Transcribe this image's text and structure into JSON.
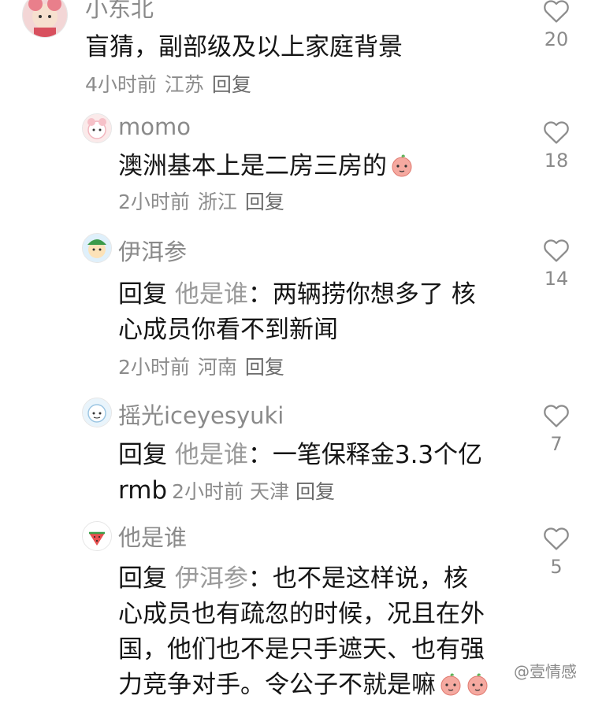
{
  "comments": [
    {
      "username": "小东北",
      "text": "盲猜，副部级及以上家庭背景",
      "time": "4小时前",
      "location": "江苏",
      "reply_label": "回复",
      "likes": "20"
    },
    {
      "username": "momo",
      "text": "澳洲基本上是二房三房的",
      "time": "2小时前",
      "location": "浙江",
      "reply_label": "回复",
      "likes": "18"
    },
    {
      "username": "伊洱参",
      "reply_prefix": "回复",
      "reply_target": "他是谁",
      "text_line1": "：两辆捞你想多了 核",
      "text_line2": "心成员你看不到新闻",
      "time": "2小时前",
      "location": "河南",
      "reply_label": "回复",
      "likes": "14"
    },
    {
      "username": "摇光iceyesyuki",
      "reply_prefix": "回复",
      "reply_target": "他是谁",
      "text_line1": "：一笔保释金3.3个亿",
      "text_line2": "rmb",
      "time": "2小时前",
      "location": "天津",
      "reply_label": "回复",
      "likes": "7"
    },
    {
      "username": "他是谁",
      "reply_prefix": "回复",
      "reply_target": "伊洱参",
      "text_line1": "：也不是这样说，核",
      "text_line2": "心成员也有疏忽的时候，况且在外",
      "text_line3": "国，他们也不是只手遮天、也有强",
      "text_line4": "力竞争对手。令公子不就是嘛",
      "likes": "5"
    }
  ],
  "watermark": "@壹情感",
  "colors": {
    "username": "#8a8a8a",
    "meta": "#8c8c8c",
    "text": "#151515"
  }
}
